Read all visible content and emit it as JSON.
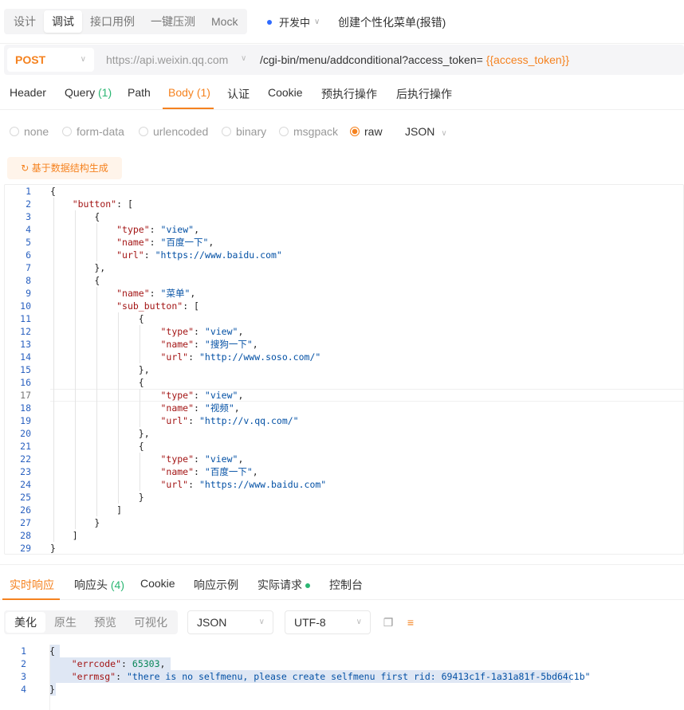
{
  "top_tabs": [
    "设计",
    "调试",
    "接口用例",
    "一键压测",
    "Mock"
  ],
  "active_top_tab": "调试",
  "environment": {
    "label": "开发中",
    "dot_color": "#2f6bff"
  },
  "api_name": "创建个性化菜单(报错)",
  "request": {
    "method": "POST",
    "base_url": "https://api.weixin.qq.com",
    "path": "/cgi-bin/menu/addconditional?access_token= ",
    "path_variable": "{{access_token}}"
  },
  "request_tabs": [
    {
      "label": "Header",
      "count": ""
    },
    {
      "label": "Query",
      "count": "(1)"
    },
    {
      "label": "Path",
      "count": ""
    },
    {
      "label": "Body",
      "count": "(1)"
    },
    {
      "label": "认证",
      "count": ""
    },
    {
      "label": "Cookie",
      "count": ""
    },
    {
      "label": "预执行操作",
      "count": ""
    },
    {
      "label": "后执行操作",
      "count": ""
    }
  ],
  "active_request_tab": "Body",
  "body_types": [
    "none",
    "form-data",
    "urlencoded",
    "binary",
    "msgpack",
    "raw"
  ],
  "selected_body_type": "raw",
  "body_format": "JSON",
  "generate_button": "基于数据结构生成",
  "body_lines": [
    "{",
    "    \"button\": [",
    "        {",
    "            \"type\": \"view\",",
    "            \"name\": \"百度一下\",",
    "            \"url\": \"https://www.baidu.com\"",
    "        },",
    "        {",
    "            \"name\": \"菜单\",",
    "            \"sub_button\": [",
    "                {",
    "                    \"type\": \"view\",",
    "                    \"name\": \"搜狗一下\",",
    "                    \"url\": \"http://www.soso.com/\"",
    "                },",
    "                {",
    "                    \"type\": \"view\",",
    "                    \"name\": \"视频\",",
    "                    \"url\": \"http://v.qq.com/\"",
    "                },",
    "                {",
    "                    \"type\": \"view\",",
    "                    \"name\": \"百度一下\",",
    "                    \"url\": \"https://www.baidu.com\"",
    "                }",
    "            ]",
    "        }",
    "    ]",
    "}"
  ],
  "response_tabs": [
    {
      "label": "实时响应",
      "count": ""
    },
    {
      "label": "响应头",
      "count": "(4)"
    },
    {
      "label": "Cookie",
      "count": ""
    },
    {
      "label": "响应示例",
      "count": ""
    },
    {
      "label": "实际请求",
      "count": ""
    },
    {
      "label": "控制台",
      "count": ""
    }
  ],
  "active_response_tab": "实时响应",
  "response_view_modes": [
    "美化",
    "原生",
    "预览",
    "可视化"
  ],
  "active_view_mode": "美化",
  "response_format": "JSON",
  "response_encoding": "UTF-8",
  "response_lines": [
    "{",
    "    \"errcode\": 65303,",
    "    \"errmsg\": \"there is no selfmenu, please create selfmenu first rid: 69413c1f-1a31a81f-5bd64c1b\"",
    "}"
  ],
  "colors": {
    "accent": "#f5821f",
    "success": "#2bb673",
    "link": "#2b62c0"
  },
  "icons": [
    "chevron-down-icon",
    "refresh-icon",
    "copy-icon",
    "wrap-lines-icon"
  ]
}
